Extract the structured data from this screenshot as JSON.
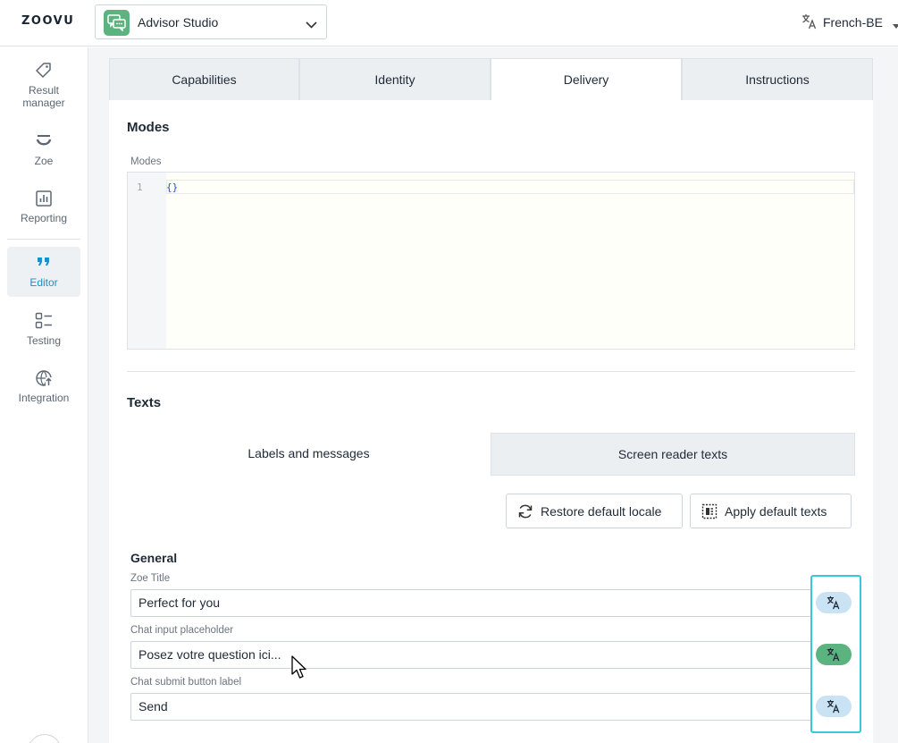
{
  "header": {
    "logo": "ZOOVU",
    "app_selector": {
      "name": "Advisor Studio"
    },
    "language": {
      "label": "French-BE"
    }
  },
  "sidebar": {
    "items": [
      {
        "label_line1": "Result",
        "label_line2": "manager",
        "icon": "tag-icon"
      },
      {
        "label": "Zoe",
        "icon": "zoe-icon"
      },
      {
        "label": "Reporting",
        "icon": "bar-chart-icon"
      },
      {
        "label": "Editor",
        "icon": "quote-icon",
        "active": true
      },
      {
        "label": "Testing",
        "icon": "checklist-icon"
      },
      {
        "label": "Integration",
        "icon": "globe-upload-icon"
      }
    ]
  },
  "tabs": [
    {
      "label": "Capabilities"
    },
    {
      "label": "Identity"
    },
    {
      "label": "Delivery",
      "active": true
    },
    {
      "label": "Instructions"
    }
  ],
  "modes": {
    "title": "Modes",
    "field_label": "Modes",
    "code": {
      "line_number": "1",
      "text": "{}"
    }
  },
  "texts": {
    "title": "Texts",
    "subtabs": [
      {
        "label": "Labels and messages",
        "active": true
      },
      {
        "label": "Screen reader texts"
      }
    ],
    "buttons": {
      "restore": "Restore default locale",
      "apply": "Apply default texts"
    },
    "group_title": "General",
    "fields": [
      {
        "label": "Zoe Title",
        "value": "Perfect for you",
        "translate_state": "default"
      },
      {
        "label": "Chat input placeholder",
        "value": "Posez votre question ici...",
        "translate_state": "translated"
      },
      {
        "label": "Chat submit button label",
        "value": "Send",
        "translate_state": "default"
      }
    ]
  },
  "colors": {
    "accent_blue": "#1a8fc9",
    "brand_green": "#5bb37f",
    "highlight_cyan": "#37c8dc",
    "translate_pill": "#c9e3f4"
  }
}
